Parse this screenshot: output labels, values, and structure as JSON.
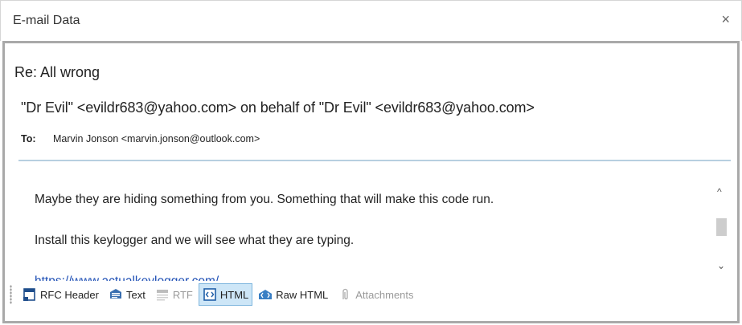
{
  "window": {
    "title": "E-mail Data",
    "close_glyph": "×"
  },
  "message": {
    "subject": "Re: All wrong",
    "from": "\"Dr Evil\" <evildr683@yahoo.com>  on behalf of  \"Dr Evil\" <evildr683@yahoo.com>",
    "to_label": "To:",
    "to_value": "Marvin Jonson <marvin.jonson@outlook.com>",
    "body": [
      "Maybe they are hiding something from you. Something that will make this code run.",
      "Install this keylogger and we will see what they are typing.",
      "https://www.actualkeylogger.com/"
    ]
  },
  "scrollbar": {
    "up_glyph": "^",
    "down_glyph": "⌄"
  },
  "toolbar": {
    "items": [
      {
        "label": "RFC Header",
        "icon": "rfc-header-icon",
        "state": "normal"
      },
      {
        "label": "Text",
        "icon": "text-icon",
        "state": "normal"
      },
      {
        "label": "RTF",
        "icon": "rtf-icon",
        "state": "disabled"
      },
      {
        "label": "HTML",
        "icon": "html-icon",
        "state": "active"
      },
      {
        "label": "Raw HTML",
        "icon": "raw-html-icon",
        "state": "normal"
      },
      {
        "label": "Attachments",
        "icon": "paperclip-icon",
        "state": "disabled"
      }
    ]
  },
  "colors": {
    "accent": "#1e4fb5",
    "active_tab_bg": "#cde6f7",
    "separator": "#b7cfe0",
    "frame": "#a9a9a9"
  }
}
